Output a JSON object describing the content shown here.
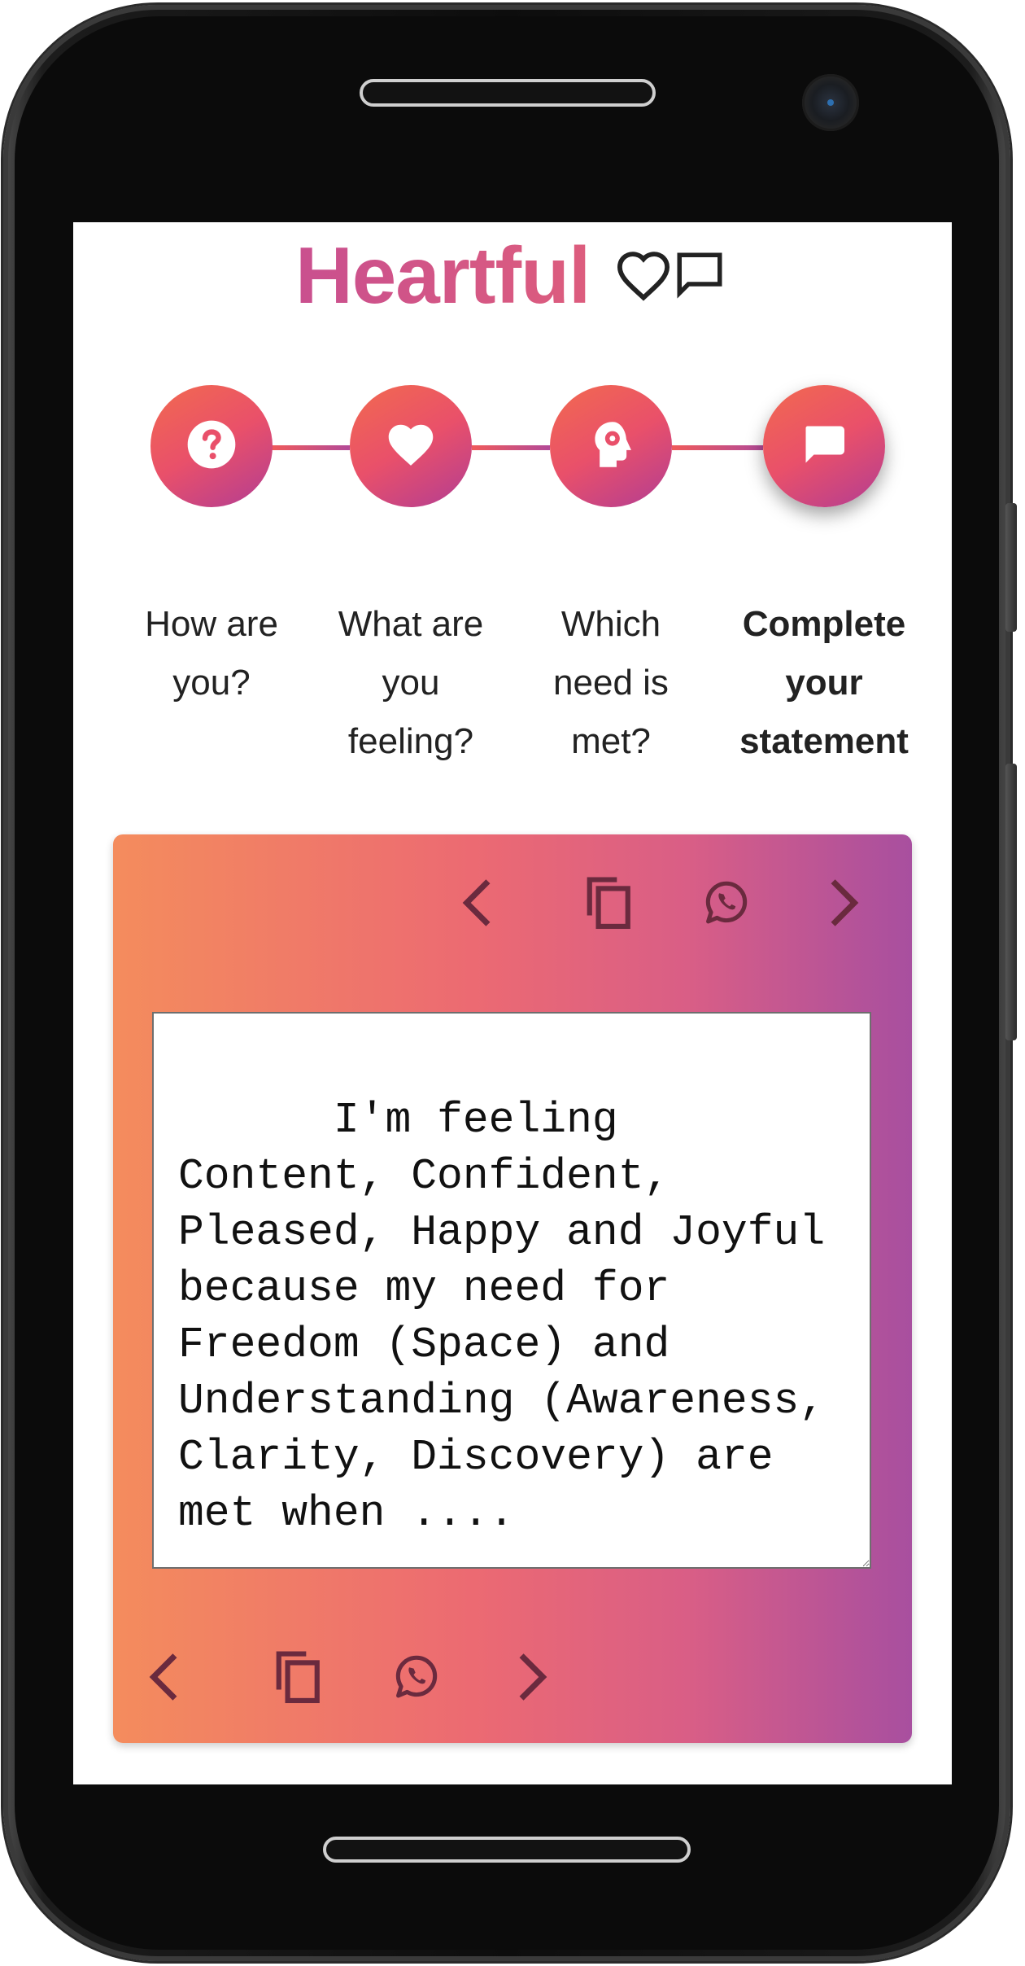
{
  "app": {
    "title": "Heartful",
    "header_icons": [
      "heart-outline-icon",
      "chat-bubble-outline-icon"
    ]
  },
  "steps": [
    {
      "label": "How are you?",
      "icon": "question-mark-icon",
      "active": false
    },
    {
      "label": "What are you feeling?",
      "icon": "heart-icon",
      "active": false
    },
    {
      "label": "Which need is met?",
      "icon": "head-gear-icon",
      "active": false
    },
    {
      "label": "Complete your statement",
      "icon": "chat-message-icon",
      "active": true
    }
  ],
  "statement": {
    "text": "I'm feeling Content, Confident, Pleased, Happy and Joyful because my need for Freedom (Space) and Understanding (Awareness, Clarity, Discovery) are met when ...."
  },
  "card_actions": {
    "top": [
      "previous-icon",
      "copy-icon",
      "whatsapp-icon",
      "next-icon"
    ],
    "bottom": [
      "previous-icon",
      "copy-icon",
      "whatsapp-icon",
      "next-icon"
    ]
  },
  "colors": {
    "brand_gradient_start": "#c94f8f",
    "brand_gradient_end": "#dd5d7d",
    "step_gradient": [
      "#f26a4f",
      "#e9506a",
      "#b23d93"
    ],
    "card_gradient": [
      "#f48c5d",
      "#ec6a72",
      "#d95e86",
      "#a84f9f"
    ],
    "card_icon_color": "#6a2a3e"
  }
}
